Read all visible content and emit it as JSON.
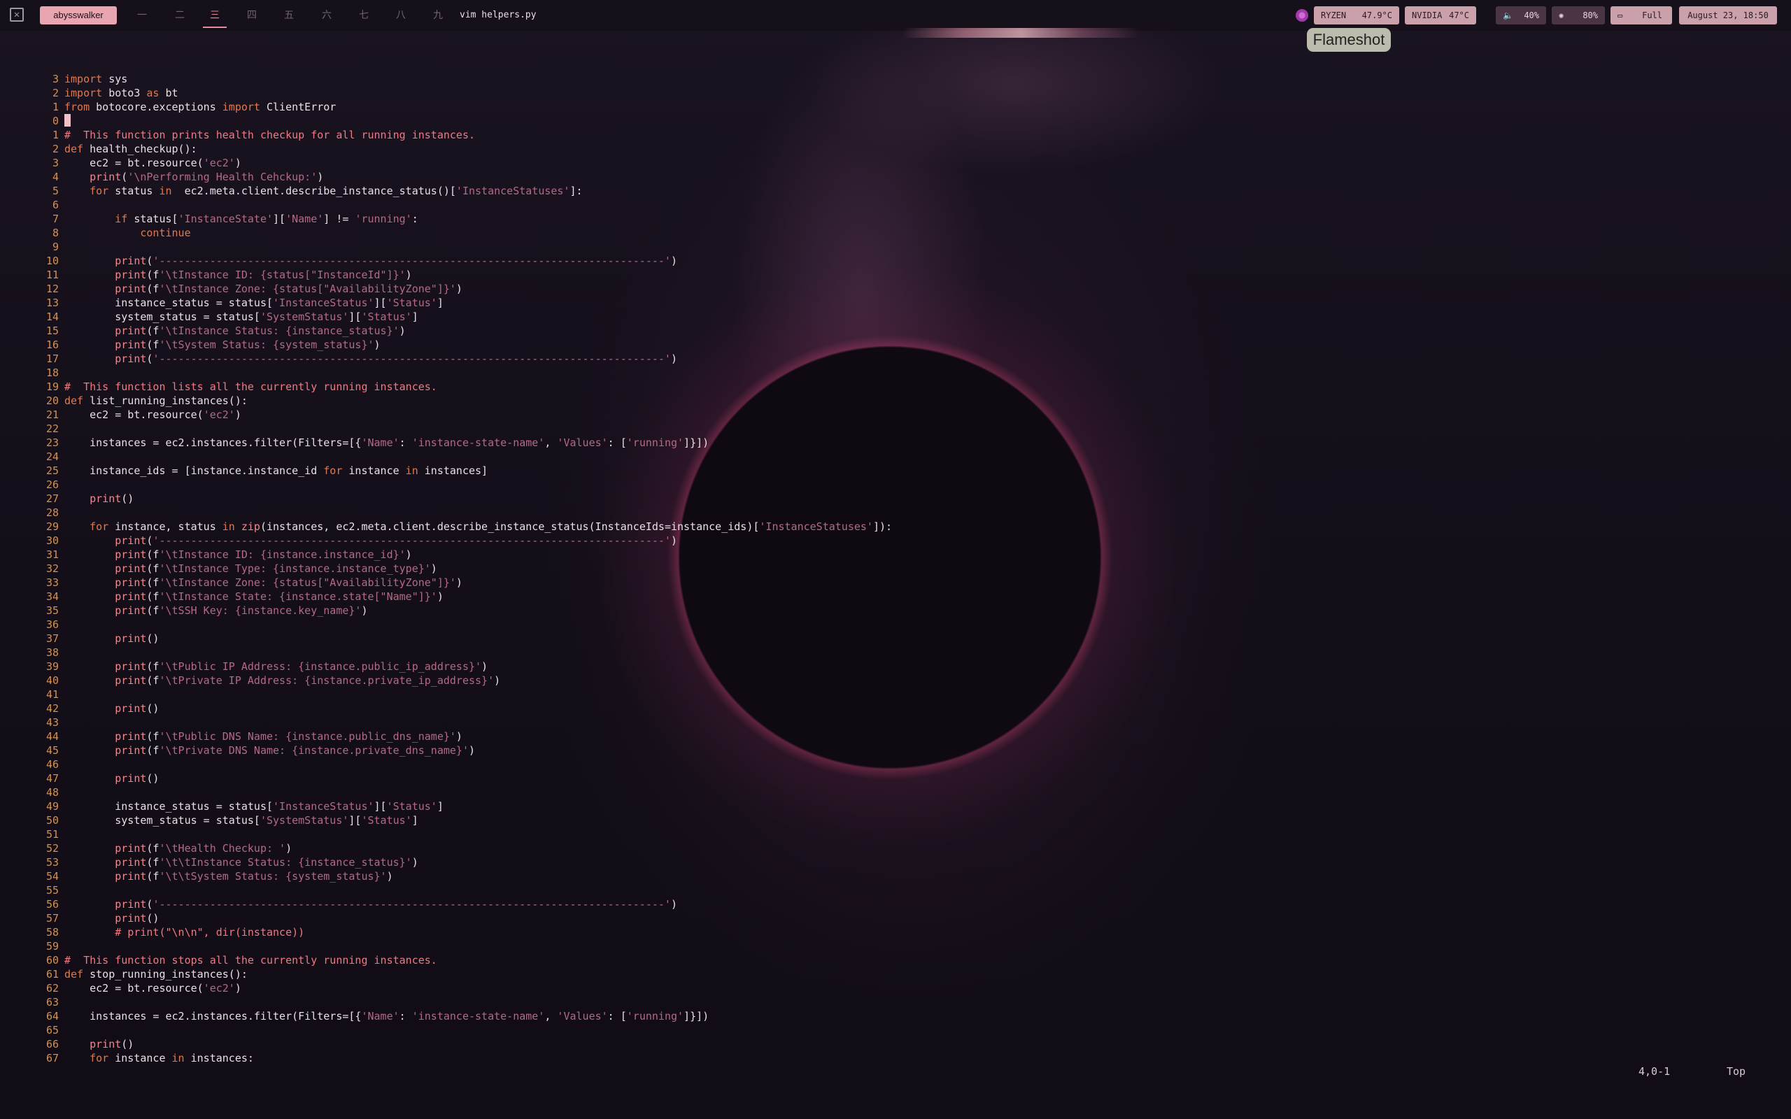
{
  "topbar": {
    "user": "abysswalker",
    "workspaces": [
      "一",
      "二",
      "三",
      "四",
      "五",
      "六",
      "七",
      "八",
      "九"
    ],
    "active_workspace": 3,
    "window_title": "vim helpers.py",
    "ryzen_label": "RYZEN",
    "ryzen_temp": "47.9°C",
    "nvidia_label": "NVIDIA",
    "nvidia_temp": "47°C",
    "volume": "40%",
    "brightness": "80%",
    "battery": "Full",
    "datetime": "August 23, 18:50",
    "accent": "#e9a6b0"
  },
  "flameshot": {
    "label": "Flameshot"
  },
  "editor": {
    "cursor_pos": "4,0-1",
    "scroll": "Top",
    "lines": [
      {
        "n": "3",
        "t": "import sys"
      },
      {
        "n": "2",
        "t": "import boto3 as bt"
      },
      {
        "n": "1",
        "t": "from botocore.exceptions import ClientError"
      },
      {
        "n": "0",
        "t": ""
      },
      {
        "n": "1",
        "t": "#  This function prints health checkup for all running instances."
      },
      {
        "n": "2",
        "t": "def health_checkup():"
      },
      {
        "n": "3",
        "t": "    ec2 = bt.resource('ec2')"
      },
      {
        "n": "4",
        "t": "    print('\\nPerforming Health Cehckup:')"
      },
      {
        "n": "5",
        "t": "    for status in  ec2.meta.client.describe_instance_status()['InstanceStatuses']:"
      },
      {
        "n": "6",
        "t": ""
      },
      {
        "n": "7",
        "t": "        if status['InstanceState']['Name'] != 'running':"
      },
      {
        "n": "8",
        "t": "            continue"
      },
      {
        "n": "9",
        "t": ""
      },
      {
        "n": "10",
        "t": "        print('--------------------------------------------------------------------------------')"
      },
      {
        "n": "11",
        "t": "        print(f'\\tInstance ID: {status[\"InstanceId\"]}')"
      },
      {
        "n": "12",
        "t": "        print(f'\\tInstance Zone: {status[\"AvailabilityZone\"]}')"
      },
      {
        "n": "13",
        "t": "        instance_status = status['InstanceStatus']['Status']"
      },
      {
        "n": "14",
        "t": "        system_status = status['SystemStatus']['Status']"
      },
      {
        "n": "15",
        "t": "        print(f'\\tInstance Status: {instance_status}')"
      },
      {
        "n": "16",
        "t": "        print(f'\\tSystem Status: {system_status}')"
      },
      {
        "n": "17",
        "t": "        print('--------------------------------------------------------------------------------')"
      },
      {
        "n": "18",
        "t": ""
      },
      {
        "n": "19",
        "t": "#  This function lists all the currently running instances."
      },
      {
        "n": "20",
        "t": "def list_running_instances():"
      },
      {
        "n": "21",
        "t": "    ec2 = bt.resource('ec2')"
      },
      {
        "n": "22",
        "t": ""
      },
      {
        "n": "23",
        "t": "    instances = ec2.instances.filter(Filters=[{'Name': 'instance-state-name', 'Values': ['running']}])"
      },
      {
        "n": "24",
        "t": ""
      },
      {
        "n": "25",
        "t": "    instance_ids = [instance.instance_id for instance in instances]"
      },
      {
        "n": "26",
        "t": ""
      },
      {
        "n": "27",
        "t": "    print()"
      },
      {
        "n": "28",
        "t": ""
      },
      {
        "n": "29",
        "t": "    for instance, status in zip(instances, ec2.meta.client.describe_instance_status(InstanceIds=instance_ids)['InstanceStatuses']):"
      },
      {
        "n": "30",
        "t": "        print('--------------------------------------------------------------------------------')"
      },
      {
        "n": "31",
        "t": "        print(f'\\tInstance ID: {instance.instance_id}')"
      },
      {
        "n": "32",
        "t": "        print(f'\\tInstance Type: {instance.instance_type}')"
      },
      {
        "n": "33",
        "t": "        print(f'\\tInstance Zone: {status[\"AvailabilityZone\"]}')"
      },
      {
        "n": "34",
        "t": "        print(f'\\tInstance State: {instance.state[\"Name\"]}')"
      },
      {
        "n": "35",
        "t": "        print(f'\\tSSH Key: {instance.key_name}')"
      },
      {
        "n": "36",
        "t": ""
      },
      {
        "n": "37",
        "t": "        print()"
      },
      {
        "n": "38",
        "t": ""
      },
      {
        "n": "39",
        "t": "        print(f'\\tPublic IP Address: {instance.public_ip_address}')"
      },
      {
        "n": "40",
        "t": "        print(f'\\tPrivate IP Address: {instance.private_ip_address}')"
      },
      {
        "n": "41",
        "t": ""
      },
      {
        "n": "42",
        "t": "        print()"
      },
      {
        "n": "43",
        "t": ""
      },
      {
        "n": "44",
        "t": "        print(f'\\tPublic DNS Name: {instance.public_dns_name}')"
      },
      {
        "n": "45",
        "t": "        print(f'\\tPrivate DNS Name: {instance.private_dns_name}')"
      },
      {
        "n": "46",
        "t": ""
      },
      {
        "n": "47",
        "t": "        print()"
      },
      {
        "n": "48",
        "t": ""
      },
      {
        "n": "49",
        "t": "        instance_status = status['InstanceStatus']['Status']"
      },
      {
        "n": "50",
        "t": "        system_status = status['SystemStatus']['Status']"
      },
      {
        "n": "51",
        "t": ""
      },
      {
        "n": "52",
        "t": "        print(f'\\tHealth Checkup: ')"
      },
      {
        "n": "53",
        "t": "        print(f'\\t\\tInstance Status: {instance_status}')"
      },
      {
        "n": "54",
        "t": "        print(f'\\t\\tSystem Status: {system_status}')"
      },
      {
        "n": "55",
        "t": ""
      },
      {
        "n": "56",
        "t": "        print('--------------------------------------------------------------------------------')"
      },
      {
        "n": "57",
        "t": "        print()"
      },
      {
        "n": "58",
        "t": "        # print(\"\\n\\n\", dir(instance))"
      },
      {
        "n": "59",
        "t": ""
      },
      {
        "n": "60",
        "t": "#  This function stops all the currently running instances."
      },
      {
        "n": "61",
        "t": "def stop_running_instances():"
      },
      {
        "n": "62",
        "t": "    ec2 = bt.resource('ec2')"
      },
      {
        "n": "63",
        "t": ""
      },
      {
        "n": "64",
        "t": "    instances = ec2.instances.filter(Filters=[{'Name': 'instance-state-name', 'Values': ['running']}])"
      },
      {
        "n": "65",
        "t": ""
      },
      {
        "n": "66",
        "t": "    print()"
      },
      {
        "n": "67",
        "t": "    for instance in instances:"
      }
    ]
  }
}
